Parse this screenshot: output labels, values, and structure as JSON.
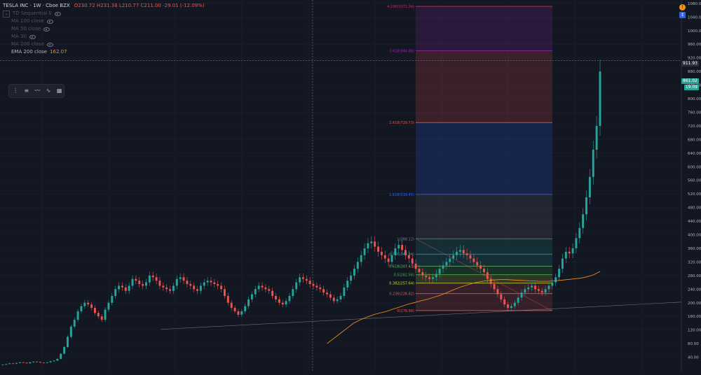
{
  "header": {
    "symbol": "TESLA INC",
    "interval": "1W",
    "exchange": "Cboe BZX",
    "ohlc": "O230.72  H231.38  L210.77  C211.00  -29.01 (-12.09%)"
  },
  "indicators": [
    {
      "label": "TD Sequential II",
      "value": ""
    },
    {
      "label": "MA 100 close",
      "value": ""
    },
    {
      "label": "MA 50 close",
      "value": ""
    },
    {
      "label": "MA 30",
      "value": ""
    },
    {
      "label": "MA 200 close",
      "value": ""
    },
    {
      "label": "EMA 200 close",
      "value": "162.07"
    }
  ],
  "toolbar": [
    "selector",
    "bars",
    "lines",
    "area",
    "heikin"
  ],
  "colors": {
    "bg": "#131722",
    "up": "#26a69a",
    "down": "#ef5350",
    "ema": "#f7931a",
    "grid": "#1e2230"
  },
  "price_tags": [
    {
      "label": "911.93",
      "color": "#2a2e39"
    },
    {
      "label": "861.02",
      "color": "#26a69a"
    },
    {
      "label": "19.09",
      "color": "#26a69a"
    }
  ],
  "corner": {
    "badge": "!",
    "button": "↕"
  },
  "chart_data": {
    "type": "candlestick",
    "title": "TESLA INC, 1W, Cboe BZX",
    "ylim": [
      0,
      1080
    ],
    "yticks": [
      40,
      80,
      120,
      160,
      200,
      240,
      280,
      320,
      360,
      400,
      440,
      480,
      520,
      560,
      600,
      640,
      680,
      720,
      760,
      800,
      840,
      880,
      920,
      960,
      1000,
      1040,
      1080
    ],
    "series": [
      {
        "name": "Close (approx, weekly)",
        "values": [
          18,
          20,
          22,
          21,
          23,
          25,
          24,
          22,
          25,
          27,
          26,
          24,
          23,
          25,
          28,
          30,
          35,
          50,
          70,
          100,
          130,
          150,
          175,
          190,
          200,
          195,
          185,
          170,
          160,
          150,
          180,
          200,
          220,
          240,
          250,
          245,
          235,
          250,
          270,
          265,
          255,
          250,
          260,
          280,
          275,
          265,
          250,
          245,
          240,
          235,
          250,
          270,
          275,
          265,
          255,
          250,
          240,
          235,
          250,
          260,
          265,
          260,
          255,
          250,
          240,
          220,
          200,
          185,
          175,
          165,
          175,
          190,
          210,
          225,
          240,
          250,
          245,
          240,
          235,
          220,
          210,
          200,
          195,
          205,
          220,
          240,
          260,
          275,
          270,
          265,
          255,
          250,
          245,
          240,
          230,
          225,
          215,
          205,
          210,
          220,
          245,
          265,
          280,
          300,
          320,
          340,
          360,
          375,
          380,
          365,
          350,
          340,
          330,
          320,
          340,
          360,
          370,
          355,
          340,
          330,
          315,
          300,
          290,
          280,
          275,
          270,
          275,
          285,
          300,
          310,
          320,
          330,
          340,
          350,
          355,
          345,
          340,
          330,
          320,
          310,
          300,
          290,
          270,
          255,
          240,
          225,
          210,
          195,
          185,
          190,
          200,
          215,
          230,
          240,
          245,
          250,
          240,
          235,
          230,
          240,
          250,
          260,
          275,
          300,
          330,
          350,
          345,
          360,
          390,
          420,
          460,
          510,
          570,
          650,
          720,
          880
        ]
      }
    ],
    "ema": {
      "name": "EMA 200 close",
      "start_week": 95,
      "values": [
        80,
        95,
        110,
        125,
        140,
        150,
        158,
        165,
        170,
        175,
        182,
        188,
        195,
        200,
        205,
        210,
        216,
        222,
        230,
        238,
        246,
        252,
        258,
        262,
        265,
        267,
        268,
        268,
        267,
        266,
        265,
        264,
        263,
        263,
        264,
        266,
        268,
        270,
        272,
        276,
        282,
        292
      ]
    },
    "fibonacci": {
      "levels": [
        {
          "ratio": "0",
          "value": 176.99,
          "label": "0(176.99)",
          "color": "#ef5350"
        },
        {
          "ratio": "0.236",
          "value": 226.82,
          "label": "0.236(226.82)",
          "color": "#ef5350"
        },
        {
          "ratio": "0.382",
          "value": 257.64,
          "label": "0.382(257.64)",
          "color": "#cddc39"
        },
        {
          "ratio": "0.5",
          "value": 282.56,
          "label": "0.5(282.56)",
          "color": "#4caf50"
        },
        {
          "ratio": "0.618",
          "value": 307.47,
          "label": "0.618(307.47)",
          "color": "#66bb6a"
        },
        {
          "ratio": "0.786",
          "value": 342.94,
          "label": "0.786(342.94)",
          "color": "#26a69a"
        },
        {
          "ratio": "1",
          "value": 388.12,
          "label": "1(388.12)",
          "color": "#787b86"
        },
        {
          "ratio": "1.618",
          "value": 518.45,
          "label": "1.618(518.45)",
          "color": "#2962ff"
        },
        {
          "ratio": "2.618",
          "value": 729.73,
          "label": "2.618(729.73)",
          "color": "#ef5350"
        },
        {
          "ratio": "3.618",
          "value": 940.86,
          "label": "3.618(940.86)",
          "color": "#9c27b0"
        },
        {
          "ratio": "4.236",
          "value": 1071.34,
          "label": "4.236(1071.34)",
          "color": "#e91e63"
        }
      ]
    }
  }
}
